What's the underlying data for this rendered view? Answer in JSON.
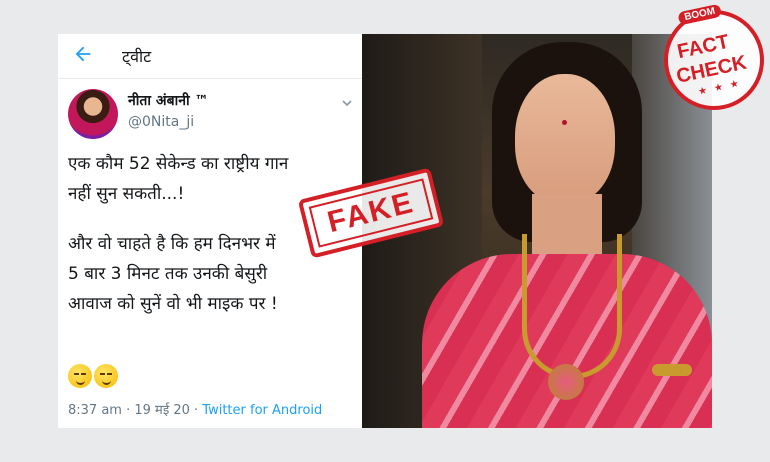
{
  "tweet": {
    "header_title": "ट्वीट",
    "author_name": "नीता अंबानी ™",
    "author_handle": "@0Nita_ji",
    "lines": [
      "एक कौम 52 सेकेन्ड का राष्ट्रीय गान",
      "नहीं सुन सकती...!",
      "और वो चाहते है कि हम दिनभर में",
      "5 बार  3 मिनट तक उनकी बेसुरी",
      "आवाज को सुनें वो भी माइक पर !"
    ],
    "emojis": [
      "smirk-emoji",
      "smirk-emoji"
    ],
    "time": "8:37 am",
    "date": "19 मई 20",
    "source": "Twitter for Android"
  },
  "stamp": {
    "text": "FAKE"
  },
  "badge": {
    "boom": "BOOM",
    "fact": "FACT",
    "check": "CHECK",
    "stars": "★ ★ ★"
  },
  "colors": {
    "accent_red": "#d41f26",
    "twitter_blue": "#1da1f2",
    "meta_gray": "#657786"
  }
}
